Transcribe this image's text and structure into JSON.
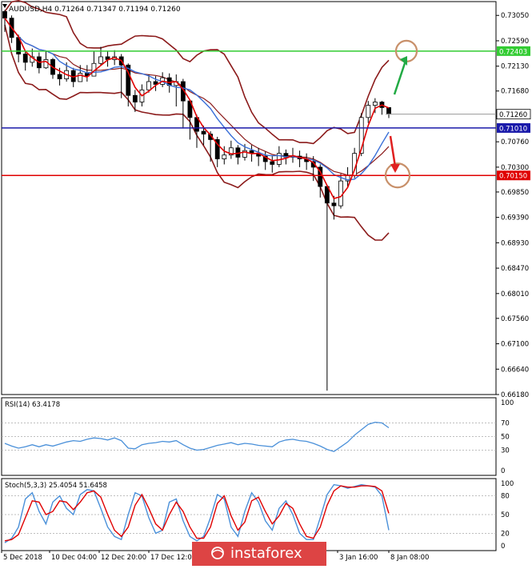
{
  "symbol_header": {
    "arrow_icon": "triangle-down-icon",
    "text": "AUDUSD,H4  0.71264 0.71347 0.71194 0.71260"
  },
  "colors": {
    "candle_up": "#ffffff",
    "candle_down": "#000000",
    "bollinger": "#8b1a1a",
    "ma_fast": "#e00000",
    "ma_slow": "#3a6fd8",
    "resistance": "#33cc33",
    "pivot": "#1a1aaa",
    "support": "#e00000",
    "target_circle": "#c8906a",
    "arrow_up": "#22aa44",
    "arrow_down": "#e02020",
    "rsi_line": "#4a90d9",
    "stoch_main": "#4a90d9",
    "stoch_signal": "#e00000",
    "watermark_bg": "#dd4444"
  },
  "chart_data": [
    {
      "type": "candlestick",
      "symbol": "AUDUSD",
      "timeframe": "H4",
      "ylim": [
        0.6618,
        0.733
      ],
      "y_ticks": [
        "0.73050",
        "0.72590",
        "0.72130",
        "0.71680",
        "0.71220",
        "0.70760",
        "0.70300",
        "0.69850",
        "0.69390",
        "0.68930",
        "0.68470",
        "0.68010",
        "0.67560",
        "0.67100",
        "0.66640",
        "0.66180"
      ],
      "x_tick_labels": [
        "5 Dec 2018",
        "10 Dec 04:00",
        "12 Dec 20:00",
        "17 Dec 12:00",
        "3 Jan 16:00",
        "8 Jan 08:00"
      ],
      "horizontal_levels": [
        {
          "value": 0.72403,
          "label": "0.72403",
          "color": "#33cc33"
        },
        {
          "value": 0.7101,
          "label": "0.71010",
          "color": "#1a1aaa"
        },
        {
          "value": 0.7015,
          "label": "0.70150",
          "color": "#e00000"
        }
      ],
      "current_price": {
        "value": 0.7126,
        "label": "0.71260"
      },
      "series": [
        {
          "name": "close",
          "values": [
            0.73,
            0.7265,
            0.7235,
            0.722,
            0.723,
            0.721,
            0.7225,
            0.7198,
            0.719,
            0.7205,
            0.7185,
            0.72,
            0.7195,
            0.7218,
            0.723,
            0.7225,
            0.723,
            0.7215,
            0.716,
            0.7148,
            0.717,
            0.7185,
            0.718,
            0.7192,
            0.7178,
            0.7185,
            0.715,
            0.712,
            0.7095,
            0.709,
            0.708,
            0.7045,
            0.7052,
            0.7065,
            0.7048,
            0.706,
            0.7055,
            0.705,
            0.704,
            0.7035,
            0.7055,
            0.7048,
            0.705,
            0.7045,
            0.704,
            0.703,
            0.6995,
            0.6965,
            0.696,
            0.7005,
            0.7015,
            0.7055,
            0.712,
            0.7142,
            0.7148,
            0.7138,
            0.7126
          ]
        },
        {
          "name": "high",
          "values": [
            0.7315,
            0.7305,
            0.727,
            0.724,
            0.7245,
            0.7238,
            0.724,
            0.7228,
            0.721,
            0.722,
            0.721,
            0.7215,
            0.7215,
            0.724,
            0.7248,
            0.724,
            0.7242,
            0.7235,
            0.7218,
            0.717,
            0.718,
            0.7198,
            0.7195,
            0.7202,
            0.72,
            0.7198,
            0.719,
            0.715,
            0.7125,
            0.7105,
            0.7095,
            0.7085,
            0.7068,
            0.7078,
            0.707,
            0.7072,
            0.707,
            0.7065,
            0.7058,
            0.705,
            0.7068,
            0.7062,
            0.7065,
            0.706,
            0.7055,
            0.705,
            0.7035,
            0.6998,
            0.6978,
            0.7018,
            0.703,
            0.7065,
            0.7128,
            0.715,
            0.7155,
            0.715,
            0.7135
          ]
        },
        {
          "name": "low",
          "values": [
            0.7275,
            0.7255,
            0.722,
            0.7205,
            0.7212,
            0.72,
            0.7208,
            0.719,
            0.7178,
            0.7185,
            0.7175,
            0.7185,
            0.7185,
            0.7195,
            0.7215,
            0.7212,
            0.7215,
            0.7155,
            0.714,
            0.713,
            0.714,
            0.7165,
            0.7168,
            0.7175,
            0.7165,
            0.714,
            0.71,
            0.708,
            0.7065,
            0.707,
            0.704,
            0.703,
            0.7035,
            0.7045,
            0.7035,
            0.7042,
            0.704,
            0.7032,
            0.7025,
            0.702,
            0.703,
            0.7035,
            0.7038,
            0.703,
            0.7025,
            0.7005,
            0.6975,
            0.6625,
            0.6935,
            0.6955,
            0.6995,
            0.701,
            0.705,
            0.711,
            0.7128,
            0.7125,
            0.7119
          ]
        }
      ]
    },
    {
      "type": "line",
      "indicator": "RSI",
      "label": "RSI(14) 63.4178",
      "ylim": [
        0,
        100
      ],
      "y_ticks": [
        "100",
        "70",
        "50",
        "30",
        "0"
      ],
      "series": [
        {
          "values": [
            40,
            36,
            33,
            35,
            38,
            35,
            38,
            36,
            39,
            42,
            44,
            43,
            46,
            48,
            47,
            45,
            48,
            44,
            33,
            32,
            38,
            40,
            41,
            43,
            42,
            44,
            38,
            33,
            30,
            31,
            34,
            37,
            39,
            41,
            38,
            40,
            39,
            37,
            36,
            35,
            42,
            45,
            46,
            44,
            43,
            40,
            36,
            31,
            28,
            35,
            42,
            52,
            60,
            68,
            71,
            70,
            63
          ]
        }
      ]
    },
    {
      "type": "line",
      "indicator": "Stochastic",
      "label": "Stoch(5,3,3) 25.4054 51.6458",
      "ylim": [
        0,
        100
      ],
      "y_ticks": [
        "100",
        "80",
        "50",
        "20",
        "0"
      ],
      "series": [
        {
          "name": "%K",
          "values": [
            5,
            12,
            30,
            75,
            85,
            55,
            35,
            70,
            80,
            60,
            50,
            82,
            90,
            88,
            60,
            30,
            15,
            10,
            50,
            85,
            80,
            45,
            20,
            25,
            70,
            75,
            40,
            15,
            8,
            15,
            45,
            82,
            75,
            30,
            15,
            55,
            85,
            70,
            40,
            25,
            60,
            72,
            50,
            20,
            10,
            10,
            45,
            82,
            98,
            96,
            92,
            95,
            98,
            96,
            94,
            80,
            25
          ]
        },
        {
          "name": "%D",
          "values": [
            8,
            10,
            18,
            45,
            72,
            70,
            50,
            55,
            72,
            70,
            58,
            70,
            85,
            88,
            78,
            50,
            25,
            15,
            30,
            65,
            82,
            60,
            35,
            25,
            50,
            70,
            55,
            30,
            12,
            12,
            30,
            68,
            80,
            48,
            25,
            38,
            72,
            78,
            55,
            35,
            48,
            68,
            60,
            35,
            15,
            12,
            30,
            65,
            88,
            96,
            94,
            94,
            96,
            96,
            95,
            88,
            52
          ]
        }
      ]
    }
  ],
  "watermark": {
    "text": "instaforex",
    "icon": "instaforex-logo-icon"
  }
}
